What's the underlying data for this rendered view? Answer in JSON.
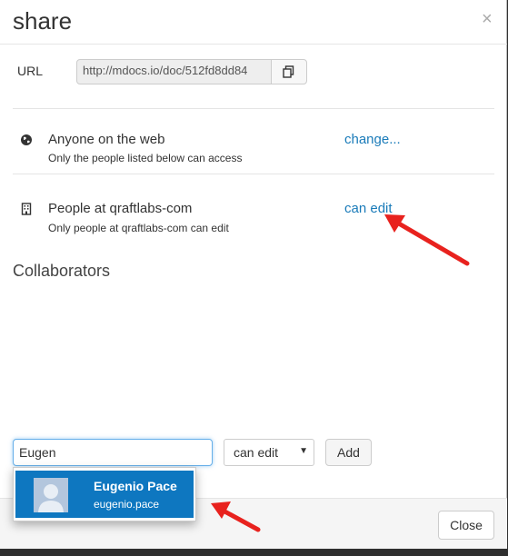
{
  "dialog": {
    "title": "share",
    "close_symbol": "×"
  },
  "url": {
    "label": "URL",
    "value": "http://mdocs.io/doc/512fd8dd84",
    "copy_icon": "copy-icon"
  },
  "access": {
    "web": {
      "icon": "globe-icon",
      "title": "Anyone on the web",
      "subtitle": "Only the people listed below can access",
      "action": "change..."
    },
    "org": {
      "icon": "building-icon",
      "title": "People at qraftlabs-com",
      "subtitle": "Only people at qraftlabs-com can edit",
      "action": "can edit"
    }
  },
  "collaborators": {
    "heading": "Collaborators"
  },
  "invite": {
    "search_value": "Eugen",
    "permission_selected": "can edit",
    "add_label": "Add"
  },
  "suggestion": {
    "name": "Eugenio Pace",
    "username": "eugenio.pace"
  },
  "footer": {
    "close_label": "Close"
  },
  "colors": {
    "link": "#1a7bb9",
    "highlight": "#0e77c0",
    "annotation_arrow": "#e8221e"
  }
}
